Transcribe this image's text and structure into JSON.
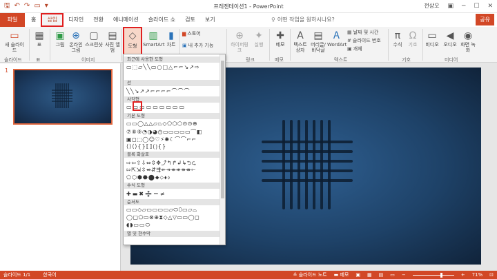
{
  "titlebar": {
    "title": "프레젠테이션1 - PowerPoint",
    "user": "전상오",
    "save_glyph": "🖫",
    "undo_glyph": "↶",
    "redo_glyph": "↷",
    "start_glyph": "▭",
    "more_glyph": "▾",
    "ribbon_opt_glyph": "▣",
    "min_glyph": "─",
    "max_glyph": "☐",
    "close_glyph": "✕"
  },
  "tabs": {
    "file": "파일",
    "items": [
      "홈",
      "삽입",
      "디자인",
      "전환",
      "애니메이션",
      "슬라이드 쇼",
      "검토",
      "보기"
    ],
    "tell_me": "어떤 작업을 원하시나요?",
    "share": "공유"
  },
  "ribbon": {
    "new_slide": "새 슬라이드",
    "table": "표",
    "picture": "그림",
    "online_picture": "온라인 그림",
    "screenshot": "스크린샷",
    "photo_album": "사진 앨범",
    "shapes": "도형",
    "smartart": "SmartArt",
    "chart": "차트",
    "store": "스토어",
    "my_addins": "내 추가 기능",
    "hyperlink": "하이퍼링크",
    "action": "실행",
    "comment": "메모",
    "textbox": "텍스트 상자",
    "header_footer": "머리글/바닥글",
    "wordart": "WordArt",
    "date_time": "날짜 및 시간",
    "slide_number": "슬라이드 번호",
    "object": "개체",
    "equation": "수식",
    "symbol": "기호",
    "video": "비디오",
    "audio": "오디오",
    "screen_recording": "화면 녹화",
    "groups": {
      "slides": "슬라이드",
      "tables": "표",
      "images": "이미지",
      "links": "링크",
      "comments": "메모",
      "text": "텍스트",
      "symbols": "기호",
      "media": "미디어"
    }
  },
  "dropdown": {
    "recent": "최근에 사용한 도형",
    "lines": "선",
    "rectangles": "사각형",
    "basic": "기본 도형",
    "block_arrows": "블록 화살표",
    "equation": "수식 도형",
    "flowchart": "순서도",
    "stars": "별 및 현수막",
    "row_recent": "▭⬚▱╲╲▭○□△⌐⌐↘↗⇨",
    "row_lines": "╲╲↘↗↗⌐⌐⌐⌐⌒⌒⌒",
    "row_rect": "▭▭▭▭▭▭▭▭▭",
    "row_basic1": "▭▭◯△△▱⏢◇⬠⬡⬡⊙⊙⊕",
    "row_basic2": "⑦⑧⑨◔◑◕◷▭▭▭▭▭⌒◧",
    "row_basic3": "▣◻⬚◯☺♡⚡✺☾⌒⌒⌐⌐",
    "row_basic4": "⟨⟩⟨⟩{}⟦⟧⟮⟯{}",
    "row_arrows1": "⇨⇦⇧⇩⇔⇕✥⤴↰↱↲↳⮌⮎",
    "row_arrows2": "⇰⇱⇲⇳⇴⇵⇶⇷⇸⇹⇺⇻⇼⇽",
    "row_arrows3": "⬠⬡⬢⬣⬤⬥⬦⬧⬨",
    "row_eq": "✚▬✖➗＝≠",
    "row_flow1": "▭▭◇▱▭▭▭▭▱⬭⬯▭▱⌓",
    "row_flow2": "◯▢⬠▭⊗⊕⧗◇△▽▭▭◯◻",
    "row_flow3": "◖◗▭▭⬭"
  },
  "thumb": {
    "number": "1"
  },
  "status": {
    "slide": "슬라이드 1/1",
    "language": "한국어",
    "notes": "슬라이드 노트",
    "comments": "메모",
    "zoom": "71%"
  },
  "colors": {
    "accent": "#d24726",
    "highlight": "#e01f1f"
  }
}
